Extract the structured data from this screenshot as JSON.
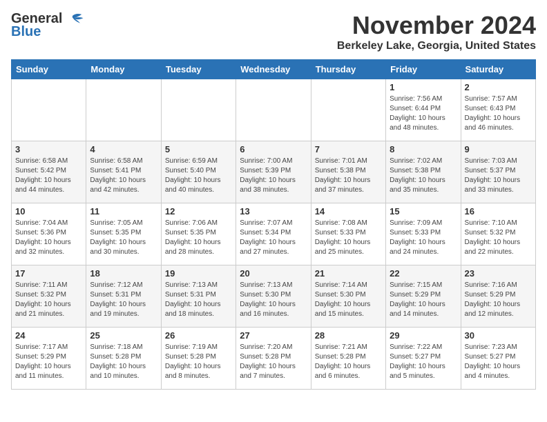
{
  "header": {
    "logo_general": "General",
    "logo_blue": "Blue",
    "month": "November 2024",
    "location": "Berkeley Lake, Georgia, United States"
  },
  "days_of_week": [
    "Sunday",
    "Monday",
    "Tuesday",
    "Wednesday",
    "Thursday",
    "Friday",
    "Saturday"
  ],
  "weeks": [
    [
      {
        "day": "",
        "sunrise": "",
        "sunset": "",
        "daylight": ""
      },
      {
        "day": "",
        "sunrise": "",
        "sunset": "",
        "daylight": ""
      },
      {
        "day": "",
        "sunrise": "",
        "sunset": "",
        "daylight": ""
      },
      {
        "day": "",
        "sunrise": "",
        "sunset": "",
        "daylight": ""
      },
      {
        "day": "",
        "sunrise": "",
        "sunset": "",
        "daylight": ""
      },
      {
        "day": "1",
        "sunrise": "Sunrise: 7:56 AM",
        "sunset": "Sunset: 6:44 PM",
        "daylight": "Daylight: 10 hours and 48 minutes."
      },
      {
        "day": "2",
        "sunrise": "Sunrise: 7:57 AM",
        "sunset": "Sunset: 6:43 PM",
        "daylight": "Daylight: 10 hours and 46 minutes."
      }
    ],
    [
      {
        "day": "3",
        "sunrise": "Sunrise: 6:58 AM",
        "sunset": "Sunset: 5:42 PM",
        "daylight": "Daylight: 10 hours and 44 minutes."
      },
      {
        "day": "4",
        "sunrise": "Sunrise: 6:58 AM",
        "sunset": "Sunset: 5:41 PM",
        "daylight": "Daylight: 10 hours and 42 minutes."
      },
      {
        "day": "5",
        "sunrise": "Sunrise: 6:59 AM",
        "sunset": "Sunset: 5:40 PM",
        "daylight": "Daylight: 10 hours and 40 minutes."
      },
      {
        "day": "6",
        "sunrise": "Sunrise: 7:00 AM",
        "sunset": "Sunset: 5:39 PM",
        "daylight": "Daylight: 10 hours and 38 minutes."
      },
      {
        "day": "7",
        "sunrise": "Sunrise: 7:01 AM",
        "sunset": "Sunset: 5:38 PM",
        "daylight": "Daylight: 10 hours and 37 minutes."
      },
      {
        "day": "8",
        "sunrise": "Sunrise: 7:02 AM",
        "sunset": "Sunset: 5:38 PM",
        "daylight": "Daylight: 10 hours and 35 minutes."
      },
      {
        "day": "9",
        "sunrise": "Sunrise: 7:03 AM",
        "sunset": "Sunset: 5:37 PM",
        "daylight": "Daylight: 10 hours and 33 minutes."
      }
    ],
    [
      {
        "day": "10",
        "sunrise": "Sunrise: 7:04 AM",
        "sunset": "Sunset: 5:36 PM",
        "daylight": "Daylight: 10 hours and 32 minutes."
      },
      {
        "day": "11",
        "sunrise": "Sunrise: 7:05 AM",
        "sunset": "Sunset: 5:35 PM",
        "daylight": "Daylight: 10 hours and 30 minutes."
      },
      {
        "day": "12",
        "sunrise": "Sunrise: 7:06 AM",
        "sunset": "Sunset: 5:35 PM",
        "daylight": "Daylight: 10 hours and 28 minutes."
      },
      {
        "day": "13",
        "sunrise": "Sunrise: 7:07 AM",
        "sunset": "Sunset: 5:34 PM",
        "daylight": "Daylight: 10 hours and 27 minutes."
      },
      {
        "day": "14",
        "sunrise": "Sunrise: 7:08 AM",
        "sunset": "Sunset: 5:33 PM",
        "daylight": "Daylight: 10 hours and 25 minutes."
      },
      {
        "day": "15",
        "sunrise": "Sunrise: 7:09 AM",
        "sunset": "Sunset: 5:33 PM",
        "daylight": "Daylight: 10 hours and 24 minutes."
      },
      {
        "day": "16",
        "sunrise": "Sunrise: 7:10 AM",
        "sunset": "Sunset: 5:32 PM",
        "daylight": "Daylight: 10 hours and 22 minutes."
      }
    ],
    [
      {
        "day": "17",
        "sunrise": "Sunrise: 7:11 AM",
        "sunset": "Sunset: 5:32 PM",
        "daylight": "Daylight: 10 hours and 21 minutes."
      },
      {
        "day": "18",
        "sunrise": "Sunrise: 7:12 AM",
        "sunset": "Sunset: 5:31 PM",
        "daylight": "Daylight: 10 hours and 19 minutes."
      },
      {
        "day": "19",
        "sunrise": "Sunrise: 7:13 AM",
        "sunset": "Sunset: 5:31 PM",
        "daylight": "Daylight: 10 hours and 18 minutes."
      },
      {
        "day": "20",
        "sunrise": "Sunrise: 7:13 AM",
        "sunset": "Sunset: 5:30 PM",
        "daylight": "Daylight: 10 hours and 16 minutes."
      },
      {
        "day": "21",
        "sunrise": "Sunrise: 7:14 AM",
        "sunset": "Sunset: 5:30 PM",
        "daylight": "Daylight: 10 hours and 15 minutes."
      },
      {
        "day": "22",
        "sunrise": "Sunrise: 7:15 AM",
        "sunset": "Sunset: 5:29 PM",
        "daylight": "Daylight: 10 hours and 14 minutes."
      },
      {
        "day": "23",
        "sunrise": "Sunrise: 7:16 AM",
        "sunset": "Sunset: 5:29 PM",
        "daylight": "Daylight: 10 hours and 12 minutes."
      }
    ],
    [
      {
        "day": "24",
        "sunrise": "Sunrise: 7:17 AM",
        "sunset": "Sunset: 5:29 PM",
        "daylight": "Daylight: 10 hours and 11 minutes."
      },
      {
        "day": "25",
        "sunrise": "Sunrise: 7:18 AM",
        "sunset": "Sunset: 5:28 PM",
        "daylight": "Daylight: 10 hours and 10 minutes."
      },
      {
        "day": "26",
        "sunrise": "Sunrise: 7:19 AM",
        "sunset": "Sunset: 5:28 PM",
        "daylight": "Daylight: 10 hours and 8 minutes."
      },
      {
        "day": "27",
        "sunrise": "Sunrise: 7:20 AM",
        "sunset": "Sunset: 5:28 PM",
        "daylight": "Daylight: 10 hours and 7 minutes."
      },
      {
        "day": "28",
        "sunrise": "Sunrise: 7:21 AM",
        "sunset": "Sunset: 5:28 PM",
        "daylight": "Daylight: 10 hours and 6 minutes."
      },
      {
        "day": "29",
        "sunrise": "Sunrise: 7:22 AM",
        "sunset": "Sunset: 5:27 PM",
        "daylight": "Daylight: 10 hours and 5 minutes."
      },
      {
        "day": "30",
        "sunrise": "Sunrise: 7:23 AM",
        "sunset": "Sunset: 5:27 PM",
        "daylight": "Daylight: 10 hours and 4 minutes."
      }
    ]
  ]
}
